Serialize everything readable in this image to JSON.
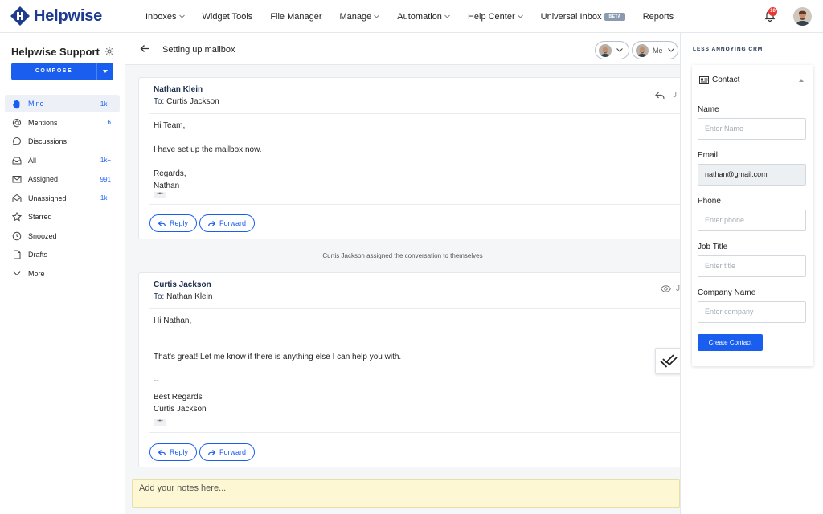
{
  "app": {
    "name": "Helpwise",
    "logo_icon": "helpwise-logo-icon"
  },
  "nav": {
    "items": [
      {
        "label": "Inboxes",
        "dropdown": true
      },
      {
        "label": "Widget Tools",
        "dropdown": false
      },
      {
        "label": "File Manager",
        "dropdown": false
      },
      {
        "label": "Manage",
        "dropdown": true
      },
      {
        "label": "Automation",
        "dropdown": true
      },
      {
        "label": "Help Center",
        "dropdown": true
      },
      {
        "label": "Universal Inbox",
        "dropdown": false,
        "badge": "BETA"
      },
      {
        "label": "Reports",
        "dropdown": false
      }
    ],
    "notification_count": "10"
  },
  "sidebar": {
    "title": "Helpwise Support",
    "compose_label": "COMPOSE",
    "items": [
      {
        "label": "Mine",
        "count": "1k+",
        "icon": "hand-icon",
        "active": true
      },
      {
        "label": "Mentions",
        "count": "6",
        "icon": "at-icon"
      },
      {
        "label": "Discussions",
        "count": "",
        "icon": "chat-bubble-icon"
      },
      {
        "label": "All",
        "count": "1k+",
        "icon": "inbox-icon"
      },
      {
        "label": "Assigned",
        "count": "991",
        "icon": "envelope-icon"
      },
      {
        "label": "Unassigned",
        "count": "1k+",
        "icon": "open-envelope-icon"
      },
      {
        "label": "Starred",
        "count": "",
        "icon": "star-icon"
      },
      {
        "label": "Snoozed",
        "count": "",
        "icon": "clock-icon"
      },
      {
        "label": "Drafts",
        "count": "",
        "icon": "document-icon"
      },
      {
        "label": "More",
        "count": "",
        "icon": "chevron-down-icon"
      }
    ]
  },
  "conversation": {
    "subject": "Setting up mailbox",
    "assignee_label": "Me",
    "messages": [
      {
        "from": "Nathan Klein",
        "to_label": "To:",
        "to": "Curtis Jackson",
        "date": "J",
        "lines": [
          "Hi Team,",
          "I have set up the mailbox now.",
          "Regards,",
          "Nathan"
        ]
      },
      {
        "from": "Curtis Jackson",
        "to_label": "To:",
        "to": "Nathan Klein",
        "date": "J",
        "lines": [
          "Hi Nathan,",
          "That's great! Let me know if there is anything else I can help you with.",
          "--",
          "Best Regards",
          "Curtis Jackson"
        ]
      }
    ],
    "system_note": "Curtis Jackson assigned the conversation to themselves",
    "reply_label": "Reply",
    "forward_label": "Forward",
    "ellipsis": "•••",
    "notes_placeholder": "Add your notes here..."
  },
  "crm": {
    "title": "LESS ANNOYING CRM",
    "card_title": "Contact",
    "fields": [
      {
        "label": "Name",
        "placeholder": "Enter Name",
        "value": ""
      },
      {
        "label": "Email",
        "placeholder": "",
        "value": "nathan@gmail.com"
      },
      {
        "label": "Phone",
        "placeholder": "Enter phone",
        "value": ""
      },
      {
        "label": "Job Title",
        "placeholder": "Enter title",
        "value": ""
      },
      {
        "label": "Company Name",
        "placeholder": "Enter company",
        "value": ""
      }
    ],
    "create_label": "Create Contact"
  },
  "colors": {
    "accent": "#1a5ef0",
    "brand": "#1d3b8f",
    "notes_bg": "#fdf8d3",
    "badge": "#e53935"
  }
}
